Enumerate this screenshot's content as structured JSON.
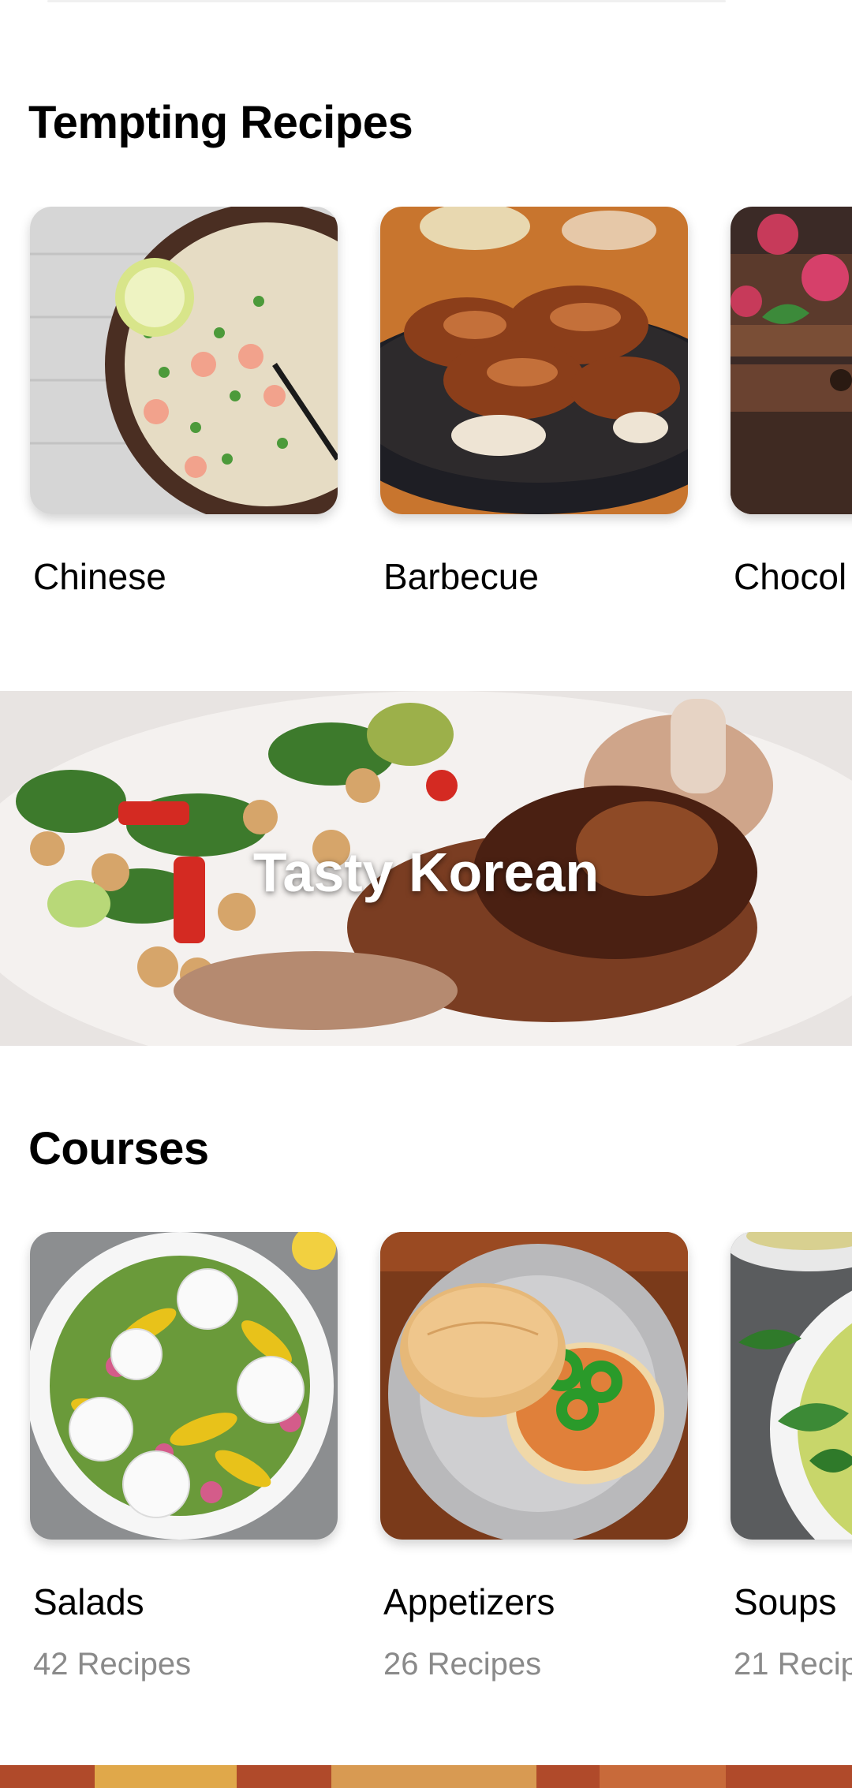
{
  "tempting": {
    "title": "Tempting Recipes",
    "items": [
      {
        "label": "Chinese",
        "image": "fried-rice-photo"
      },
      {
        "label": "Barbecue",
        "image": "grilled-chicken-photo"
      },
      {
        "label": "Chocol",
        "image": "chocolate-dessert-photo"
      }
    ]
  },
  "banner": {
    "title": "Tasty Korean",
    "image": "roast-meat-and-salad-photo"
  },
  "courses": {
    "title": "Courses",
    "items": [
      {
        "label": "Salads",
        "count": "42 Recipes",
        "image": "salad-bowl-photo"
      },
      {
        "label": "Appetizers",
        "count": "26 Recipes",
        "image": "veggie-burger-photo"
      },
      {
        "label": "Soups",
        "count": "21 Recip",
        "image": "green-soup-photo"
      }
    ]
  }
}
